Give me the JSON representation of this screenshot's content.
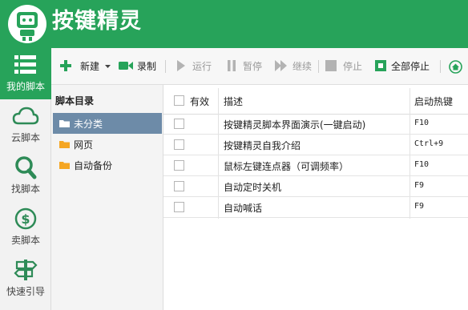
{
  "app": {
    "title": "按键精灵",
    "brand_color": "#27a35a"
  },
  "sidebar": {
    "items": [
      {
        "label": "我的脚本",
        "icon": "list-icon",
        "active": true
      },
      {
        "label": "云脚本",
        "icon": "cloud-icon"
      },
      {
        "label": "找脚本",
        "icon": "search-icon"
      },
      {
        "label": "卖脚本",
        "icon": "dollar-icon"
      },
      {
        "label": "快速引导",
        "icon": "signpost-icon"
      }
    ]
  },
  "toolbar": {
    "new_label": "新建",
    "record_label": "录制",
    "run_label": "运行",
    "pause_label": "暂停",
    "continue_label": "继续",
    "stop_label": "停止",
    "stop_all_label": "全部停止"
  },
  "directory": {
    "title": "脚本目录",
    "items": [
      {
        "label": "未分类",
        "selected": true
      },
      {
        "label": "网页"
      },
      {
        "label": "自动备份"
      }
    ]
  },
  "table": {
    "headers": {
      "enabled": "有效",
      "description": "描述",
      "hotkey": "启动热键"
    },
    "rows": [
      {
        "description": "按键精灵脚本界面演示(一键启动)",
        "hotkey": "F10",
        "enabled": false
      },
      {
        "description": "按键精灵自我介绍",
        "hotkey": "Ctrl+9",
        "enabled": false
      },
      {
        "description": "鼠标左键连点器（可调频率）",
        "hotkey": "F10",
        "enabled": false
      },
      {
        "description": "自动定时关机",
        "hotkey": "F9",
        "enabled": false
      },
      {
        "description": "自动喊话",
        "hotkey": "F9",
        "enabled": false
      }
    ]
  }
}
